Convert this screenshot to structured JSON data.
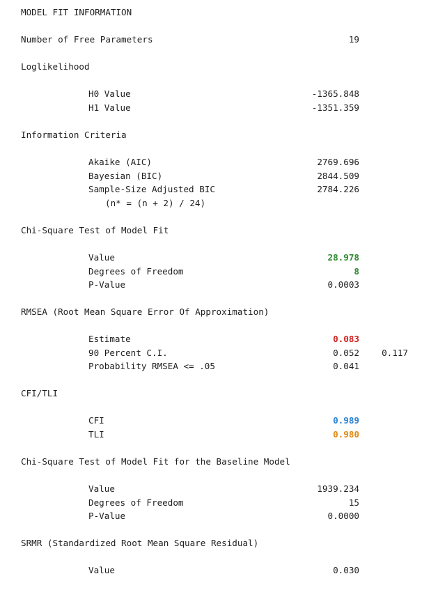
{
  "title": "MODEL FIT INFORMATION",
  "free_params": {
    "label": "Number of Free Parameters",
    "value": "19"
  },
  "loglik": {
    "heading": "Loglikelihood",
    "h0_label": "H0 Value",
    "h0_value": "-1365.848",
    "h1_label": "H1 Value",
    "h1_value": "-1351.359"
  },
  "info_criteria": {
    "heading": "Information Criteria",
    "aic_label": "Akaike (AIC)",
    "aic_value": "2769.696",
    "bic_label": "Bayesian (BIC)",
    "bic_value": "2844.509",
    "sabic_label": "Sample-Size Adjusted BIC",
    "sabic_value": "2784.226",
    "sabic_note": "(n* = (n + 2) / 24)"
  },
  "chisq": {
    "heading": "Chi-Square Test of Model Fit",
    "value_label": "Value",
    "value": "28.978",
    "df_label": "Degrees of Freedom",
    "df": "8",
    "p_label": "P-Value",
    "p": "0.0003"
  },
  "rmsea": {
    "heading": "RMSEA (Root Mean Square Error Of Approximation)",
    "est_label": "Estimate",
    "estimate": "0.083",
    "ci_label": "90 Percent C.I.",
    "ci_low": "0.052",
    "ci_high": "0.117",
    "prob_label": "Probability RMSEA <= .05",
    "prob": "0.041"
  },
  "cfitli": {
    "heading": "CFI/TLI",
    "cfi_label": "CFI",
    "cfi": "0.989",
    "tli_label": "TLI",
    "tli": "0.980"
  },
  "baseline": {
    "heading": "Chi-Square Test of Model Fit for the Baseline Model",
    "value_label": "Value",
    "value": "1939.234",
    "df_label": "Degrees of Freedom",
    "df": "15",
    "p_label": "P-Value",
    "p": "0.0000"
  },
  "srmr": {
    "heading": "SRMR (Standardized Root Mean Square Residual)",
    "value_label": "Value",
    "value": "0.030"
  },
  "colors": {
    "green": "#2f8a2f",
    "red": "#d21e1e",
    "blue": "#2b82d4",
    "orange": "#e08a10"
  }
}
